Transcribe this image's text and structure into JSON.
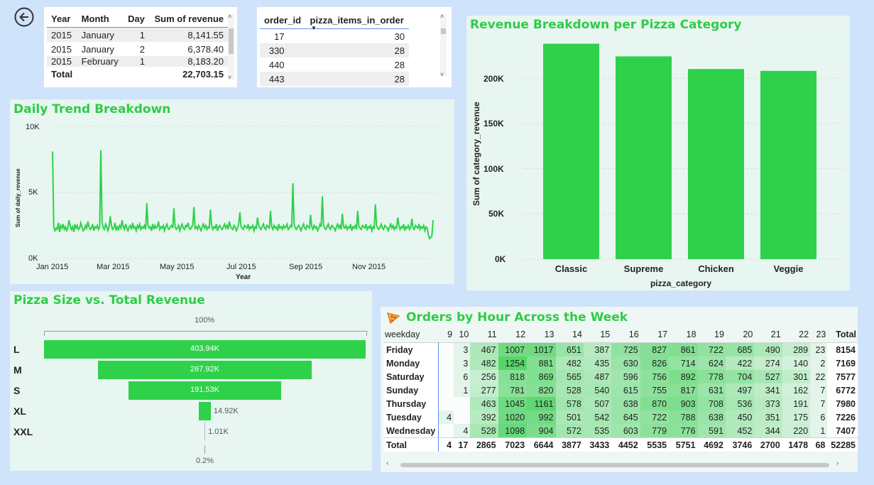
{
  "colors": {
    "accent": "#2ecc47",
    "bar": "#2fd14a",
    "panel_bg": "#e8f6f1",
    "page_bg": "#cfe3fb"
  },
  "back_button": {
    "icon": "back-arrow-icon"
  },
  "revenue_table": {
    "headers": [
      "Year",
      "Month",
      "Day",
      "Sum of revenue"
    ],
    "rows": [
      [
        "2015",
        "January",
        "1",
        "8,141.55"
      ],
      [
        "2015",
        "January",
        "2",
        "6,378.40"
      ],
      [
        "2015",
        "February",
        "1",
        "8,183.20"
      ]
    ],
    "total_label": "Total",
    "total_value": "22,703.15"
  },
  "orders_table": {
    "headers": [
      "order_id",
      "pizza_items_in_order"
    ],
    "rows": [
      [
        "17",
        "30"
      ],
      [
        "330",
        "28"
      ],
      [
        "440",
        "28"
      ],
      [
        "443",
        "28"
      ]
    ]
  },
  "daily_trend": {
    "title": "Daily Trend Breakdown",
    "xlabel": "Year",
    "ylabel": "Sum of daily_revenue",
    "yticks": [
      "10K",
      "5K",
      "0K"
    ],
    "xticks": [
      "Jan 2015",
      "Mar 2015",
      "May 2015",
      "Jul 2015",
      "Sep 2015",
      "Nov 2015"
    ]
  },
  "category_chart": {
    "title": "Revenue Breakdown per Pizza Category",
    "xlabel": "pizza_category",
    "ylabel": "Sum of category_revenue",
    "yticks": [
      "200K",
      "150K",
      "100K",
      "50K",
      "0K"
    ]
  },
  "size_chart": {
    "title": "Pizza Size vs. Total Revenue",
    "top_label": "100%",
    "bottom_label": "0.2%",
    "sizes": [
      {
        "label": "L",
        "value": "403.94K"
      },
      {
        "label": "M",
        "value": "267.92K"
      },
      {
        "label": "S",
        "value": "191.53K"
      },
      {
        "label": "XL",
        "value": "14.92K"
      },
      {
        "label": "XXL",
        "value": "1.01K"
      }
    ]
  },
  "heatmap": {
    "title": "Orders by Hour Across the Week",
    "icon": "pizza-icon",
    "corner": "weekday",
    "hours": [
      "9",
      "10",
      "11",
      "12",
      "13",
      "14",
      "15",
      "16",
      "17",
      "18",
      "19",
      "20",
      "21",
      "22",
      "23"
    ],
    "total_label": "Total",
    "rows": [
      {
        "day": "Friday",
        "cells": [
          "",
          "3",
          "467",
          "1007",
          "1017",
          "651",
          "387",
          "725",
          "827",
          "861",
          "722",
          "685",
          "490",
          "289",
          "23"
        ],
        "total": "8154"
      },
      {
        "day": "Monday",
        "cells": [
          "",
          "3",
          "482",
          "1254",
          "881",
          "482",
          "435",
          "630",
          "826",
          "714",
          "624",
          "422",
          "274",
          "140",
          "2"
        ],
        "total": "7169"
      },
      {
        "day": "Saturday",
        "cells": [
          "",
          "6",
          "256",
          "818",
          "869",
          "565",
          "487",
          "596",
          "756",
          "892",
          "778",
          "704",
          "527",
          "301",
          "22"
        ],
        "total": "7577"
      },
      {
        "day": "Sunday",
        "cells": [
          "",
          "1",
          "277",
          "781",
          "820",
          "528",
          "540",
          "615",
          "755",
          "817",
          "631",
          "497",
          "341",
          "162",
          "7"
        ],
        "total": "6772"
      },
      {
        "day": "Thursday",
        "cells": [
          "",
          "",
          "463",
          "1045",
          "1161",
          "578",
          "507",
          "638",
          "870",
          "903",
          "708",
          "536",
          "373",
          "191",
          "7"
        ],
        "total": "7980"
      },
      {
        "day": "Tuesday",
        "cells": [
          "4",
          "",
          "392",
          "1020",
          "992",
          "501",
          "542",
          "645",
          "722",
          "788",
          "638",
          "450",
          "351",
          "175",
          "6"
        ],
        "total": "7226"
      },
      {
        "day": "Wednesday",
        "cells": [
          "",
          "4",
          "528",
          "1098",
          "904",
          "572",
          "535",
          "603",
          "779",
          "776",
          "591",
          "452",
          "344",
          "220",
          "1"
        ],
        "total": "7407"
      }
    ],
    "totals": {
      "day": "Total",
      "cells": [
        "4",
        "17",
        "2865",
        "7023",
        "6644",
        "3877",
        "3433",
        "4452",
        "5535",
        "5751",
        "4692",
        "3746",
        "2700",
        "1478",
        "68"
      ],
      "total": "52285"
    }
  },
  "chart_data": [
    {
      "type": "line",
      "title": "Daily Trend Breakdown",
      "xlabel": "Year",
      "ylabel": "Sum of daily_revenue",
      "ylim": [
        0,
        10000
      ],
      "x_ticks": [
        "Jan 2015",
        "Mar 2015",
        "May 2015",
        "Jul 2015",
        "Sep 2015",
        "Nov 2015"
      ],
      "series": [
        {
          "values": [
            8100,
            2400,
            2100,
            2300,
            2200,
            2700,
            2000,
            2500,
            2300,
            2600,
            2200,
            2400,
            2100,
            2300,
            2900,
            2500,
            2200,
            2400,
            2000,
            2600,
            2300,
            2500,
            2200,
            2300,
            2700,
            2400,
            2100,
            2200,
            2500,
            2300,
            2800,
            2400,
            2200,
            2300,
            2600,
            2100,
            2400,
            2300,
            2500,
            2200,
            2400,
            8200,
            2800,
            2300,
            2200,
            2600,
            2400,
            2100,
            2400,
            3200,
            2500,
            2200,
            2300,
            2700,
            2100,
            2400,
            2200,
            2500,
            2300,
            2900,
            2400,
            2200,
            2600,
            2300,
            2100,
            2400,
            2500,
            2200,
            2700,
            2300,
            2400,
            2100,
            2500,
            2300,
            2600,
            2200,
            2400,
            2300,
            2500,
            2200,
            4200,
            2500,
            2300,
            2400,
            2100,
            2600,
            2200,
            2500,
            2300,
            2400,
            2800,
            2200,
            2400,
            2300,
            2500,
            2100,
            2400,
            2600,
            2300,
            2200,
            2400,
            2500,
            2300,
            3800,
            2400,
            2200,
            2300,
            2500,
            2100,
            2400,
            2600,
            2300,
            2200,
            2500,
            2400,
            2700,
            2300,
            2200,
            2400,
            2500,
            3900,
            2300,
            2400,
            2200,
            2500,
            2300,
            2100,
            2400,
            2600,
            2300,
            2500,
            2200,
            2400,
            2300,
            3700,
            2500,
            2200,
            2400,
            2300,
            2600,
            2100,
            2400,
            2500,
            2300,
            2200,
            2400,
            2600,
            2300,
            2500,
            2200,
            2800,
            2400,
            2300,
            2200,
            2500,
            2400,
            2100,
            2300,
            2600,
            3500,
            2400,
            2300,
            2200,
            2500,
            2400,
            2300,
            2600,
            2200,
            2400,
            2300,
            2500,
            2100,
            2400,
            2300,
            3100,
            2500,
            2300,
            2200,
            2400,
            2600,
            2300,
            2200,
            2500,
            2400,
            2300,
            3600,
            2400,
            2200,
            2500,
            2300,
            2400,
            2100,
            2600,
            2300,
            2400,
            2200,
            2500,
            2300,
            2400,
            2600,
            2200,
            2300,
            2500,
            2400,
            5700,
            2600,
            2300,
            2200,
            2400,
            2500,
            2300,
            2100,
            2400,
            2600,
            2300,
            2200,
            2500,
            2400,
            2300,
            3300,
            2400,
            2200,
            2500,
            2300,
            2400,
            2100,
            2300,
            2600,
            2400,
            4700,
            2500,
            2300,
            2200,
            2400,
            2600,
            2300,
            2200,
            2500,
            2400,
            2300,
            2100,
            2400,
            2600,
            2300,
            2500,
            2200,
            3400,
            2400,
            2300,
            2500,
            2200,
            2400,
            2300,
            2600,
            2100,
            2400,
            2300,
            2500,
            2200,
            3600,
            2400,
            2300,
            2200,
            2500,
            2400,
            2300,
            2600,
            2200,
            2400,
            2300,
            2500,
            2100,
            2400,
            2300,
            4100,
            2500,
            2300,
            2200,
            2400,
            2600,
            2300,
            2200,
            2500,
            2400,
            2300,
            2100,
            2400,
            2600,
            2300,
            2500,
            2200,
            2400,
            2300,
            3100,
            2500,
            2200,
            2400,
            2300,
            2600,
            2100,
            2400,
            2300,
            2500,
            2200,
            2400,
            3000,
            2300,
            2200,
            2500,
            2400,
            2300,
            2600,
            2200,
            2400,
            2300,
            2500,
            2100,
            2400,
            2300,
            1800,
            1500,
            1600,
            1700,
            2900
          ]
        }
      ]
    },
    {
      "type": "bar",
      "title": "Revenue Breakdown per Pizza Category",
      "xlabel": "pizza_category",
      "ylabel": "Sum of category_revenue",
      "ylim": [
        0,
        250000
      ],
      "categories": [
        "Classic",
        "Supreme",
        "Chicken",
        "Veggie"
      ],
      "values": [
        238000,
        224000,
        210000,
        208000
      ]
    },
    {
      "type": "bar",
      "orientation": "funnel",
      "title": "Pizza Size vs. Total Revenue",
      "categories": [
        "L",
        "M",
        "S",
        "XL",
        "XXL"
      ],
      "values": [
        403940,
        267920,
        191530,
        14920,
        1010
      ]
    }
  ]
}
